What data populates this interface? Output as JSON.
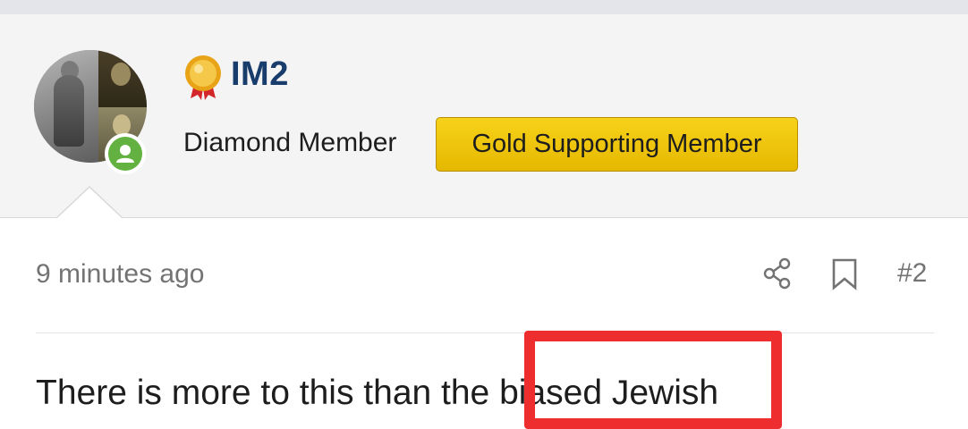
{
  "user": {
    "name": "IM2",
    "rank": "Diamond Member",
    "badge": "Gold Supporting Member",
    "online": true
  },
  "post": {
    "time": "9 minutes ago",
    "number": "#2",
    "text": "There is more to this than the biased Jewish"
  },
  "icons": {
    "medal": "medal-icon",
    "online": "user-online-icon",
    "share": "share-icon",
    "bookmark": "bookmark-icon"
  },
  "colors": {
    "username": "#183c6b",
    "badge": "#f0c400",
    "online": "#63b141",
    "highlight": "#ee2e2e"
  }
}
